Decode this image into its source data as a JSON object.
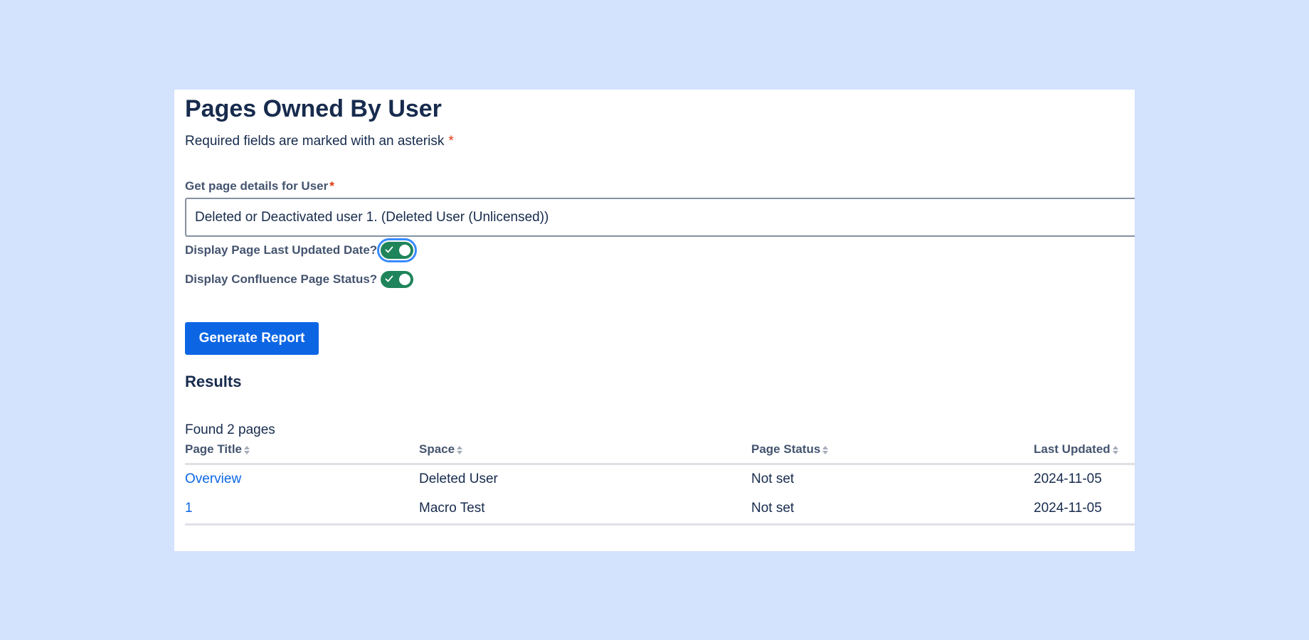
{
  "header": {
    "title": "Pages Owned By User",
    "required_note": "Required fields are marked with an asterisk",
    "asterisk": "*"
  },
  "form": {
    "user_field": {
      "label": "Get page details for User",
      "asterisk": "*",
      "value": "Deleted or Deactivated user 1. (Deleted User (Unlicensed))"
    },
    "toggles": [
      {
        "label": "Display Page Last Updated Date?",
        "checked": true
      },
      {
        "label": "Display Confluence Page Status?",
        "checked": true
      }
    ],
    "generate_button_label": "Generate Report"
  },
  "results": {
    "heading": "Results",
    "found_text": "Found 2 pages",
    "columns": [
      "Page Title",
      "Space",
      "Page Status",
      "Last Updated"
    ],
    "rows": [
      {
        "title": "Overview",
        "space": "Deleted User",
        "status": "Not set",
        "updated": "2024-11-05"
      },
      {
        "title": "1",
        "space": "Macro Test",
        "status": "Not set",
        "updated": "2024-11-05"
      }
    ]
  },
  "colors": {
    "background": "#d3e2fd",
    "primary": "#0c66e4",
    "toggle_on": "#1f845a",
    "required": "#de350b"
  }
}
